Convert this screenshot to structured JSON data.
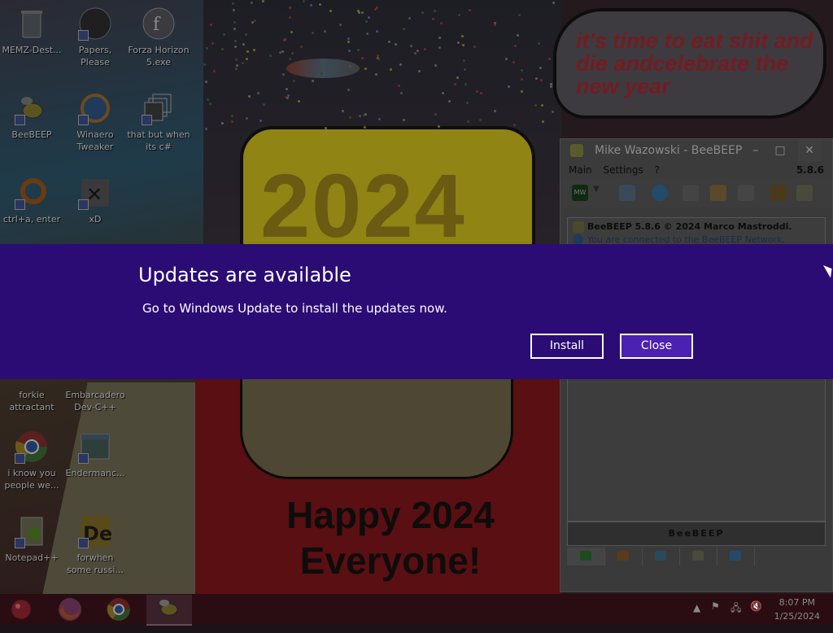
{
  "wallpaper": {
    "speech_bubble_text": "it's time to eat shit and die andcelebrate the new year",
    "cake_text": "2024",
    "bottom_text": "Happy 2024 Everyone!"
  },
  "desktop_icons": [
    {
      "label": "MEMZ-Dest...",
      "icon": "recycle-bin-icon"
    },
    {
      "label": "Papers, Please",
      "icon": "app-icon"
    },
    {
      "label": "Forza Horizon 5.exe",
      "icon": "flash-icon"
    },
    {
      "label": "BeeBEEP",
      "icon": "bee-icon"
    },
    {
      "label": "Winaero Tweaker",
      "icon": "winaero-icon"
    },
    {
      "label": "that but when its c#",
      "icon": "windows-stack-icon"
    },
    {
      "label": "ctrl+a, enter",
      "icon": "ring-icon"
    },
    {
      "label": "xD",
      "icon": "x-icon"
    },
    {
      "label": "forkie attractant",
      "icon": "image-icon"
    },
    {
      "label": "Embarcadero Dev-C++",
      "icon": "devcpp-icon"
    },
    {
      "label": "i know you people we...",
      "icon": "chrome-icon"
    },
    {
      "label": "Endermanc...",
      "icon": "window-icon"
    },
    {
      "label": "Notepad++",
      "icon": "notepad-icon"
    },
    {
      "label": "forwhen some russi...",
      "icon": "de-icon"
    }
  ],
  "beebeep": {
    "title": "Mike Wazowski - BeeBEEP",
    "menu": [
      "Main",
      "Settings",
      "?"
    ],
    "version": "5.8.6",
    "status_avatar": "MW",
    "chat_line1": "BeeBEEP 5.8.6 © 2024 Marco Mastroddi.",
    "chat_line2": "You are connected to the BeeBEEP Network.",
    "banner": "BeeBEEP"
  },
  "notification": {
    "title": "Updates are available",
    "message": "Go to Windows Update to install the updates now.",
    "install_label": "Install",
    "close_label": "Close",
    "background_color": "#2b0c75"
  },
  "taskbar": {
    "items": [
      "start-orb-icon",
      "firefox-icon",
      "chrome-icon",
      "bee-icon"
    ],
    "time": "8:07 PM",
    "date": "1/25/2024"
  }
}
